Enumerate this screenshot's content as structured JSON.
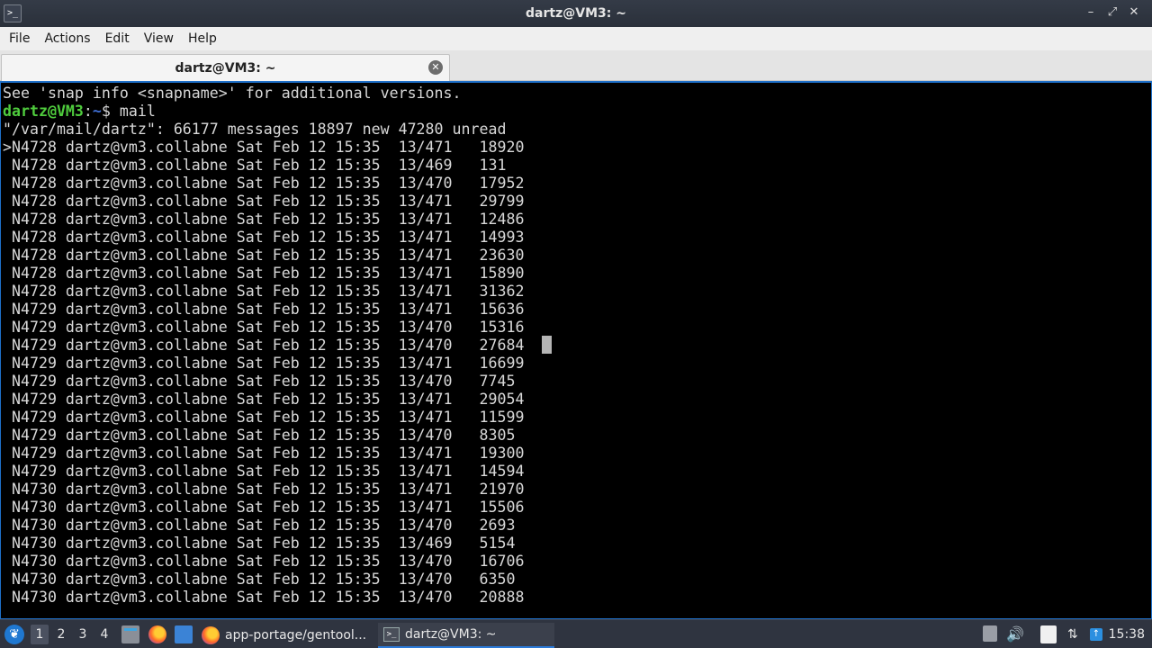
{
  "window": {
    "title": "dartz@VM3: ~",
    "icon": "terminal-icon",
    "buttons": [
      "minimize-icon",
      "maximize-icon",
      "close-icon"
    ]
  },
  "menu": [
    "File",
    "Actions",
    "Edit",
    "View",
    "Help"
  ],
  "tab": {
    "label": "dartz@VM3: ~",
    "close_icon": "close-circle-icon"
  },
  "terminal": {
    "line0": "See 'snap info <snapname>' for additional versions.",
    "prompt_user": "dartz@VM3",
    "prompt_sep": ":",
    "prompt_path": "~",
    "prompt_cmd": "$ mail",
    "header": "\"/var/mail/dartz\": 66177 messages 18897 new 47280 unread",
    "messages": [
      ">N4728 dartz@vm3.collabne Sat Feb 12 15:35  13/471   18920",
      " N4728 dartz@vm3.collabne Sat Feb 12 15:35  13/469   131",
      " N4728 dartz@vm3.collabne Sat Feb 12 15:35  13/470   17952",
      " N4728 dartz@vm3.collabne Sat Feb 12 15:35  13/471   29799",
      " N4728 dartz@vm3.collabne Sat Feb 12 15:35  13/471   12486",
      " N4728 dartz@vm3.collabne Sat Feb 12 15:35  13/471   14993",
      " N4728 dartz@vm3.collabne Sat Feb 12 15:35  13/471   23630",
      " N4728 dartz@vm3.collabne Sat Feb 12 15:35  13/471   15890",
      " N4728 dartz@vm3.collabne Sat Feb 12 15:35  13/471   31362",
      " N4729 dartz@vm3.collabne Sat Feb 12 15:35  13/471   15636",
      " N4729 dartz@vm3.collabne Sat Feb 12 15:35  13/470   15316",
      " N4729 dartz@vm3.collabne Sat Feb 12 15:35  13/470   27684",
      " N4729 dartz@vm3.collabne Sat Feb 12 15:35  13/471   16699",
      " N4729 dartz@vm3.collabne Sat Feb 12 15:35  13/470   7745",
      " N4729 dartz@vm3.collabne Sat Feb 12 15:35  13/471   29054",
      " N4729 dartz@vm3.collabne Sat Feb 12 15:35  13/471   11599",
      " N4729 dartz@vm3.collabne Sat Feb 12 15:35  13/470   8305",
      " N4729 dartz@vm3.collabne Sat Feb 12 15:35  13/471   19300",
      " N4729 dartz@vm3.collabne Sat Feb 12 15:35  13/471   14594",
      " N4730 dartz@vm3.collabne Sat Feb 12 15:35  13/471   21970",
      " N4730 dartz@vm3.collabne Sat Feb 12 15:35  13/471   15506",
      " N4730 dartz@vm3.collabne Sat Feb 12 15:35  13/470   2693",
      " N4730 dartz@vm3.collabne Sat Feb 12 15:35  13/469   5154",
      " N4730 dartz@vm3.collabne Sat Feb 12 15:35  13/470   16706",
      " N4730 dartz@vm3.collabne Sat Feb 12 15:35  13/470   6350",
      " N4730 dartz@vm3.collabne Sat Feb 12 15:35  13/470   20888"
    ]
  },
  "taskbar": {
    "workspaces": [
      "1",
      "2",
      "3",
      "4"
    ],
    "tasks": [
      {
        "label": "app-portage/gentool...",
        "icon": "firefox-icon"
      },
      {
        "label": "dartz@VM3: ~",
        "icon": "terminal-icon"
      }
    ],
    "clock": "15:38"
  },
  "colors": {
    "prompt_user": "#4fcc3d",
    "prompt_path": "#3f6fd6",
    "terminal_bg": "#000000",
    "accent": "#1e6fc8"
  }
}
